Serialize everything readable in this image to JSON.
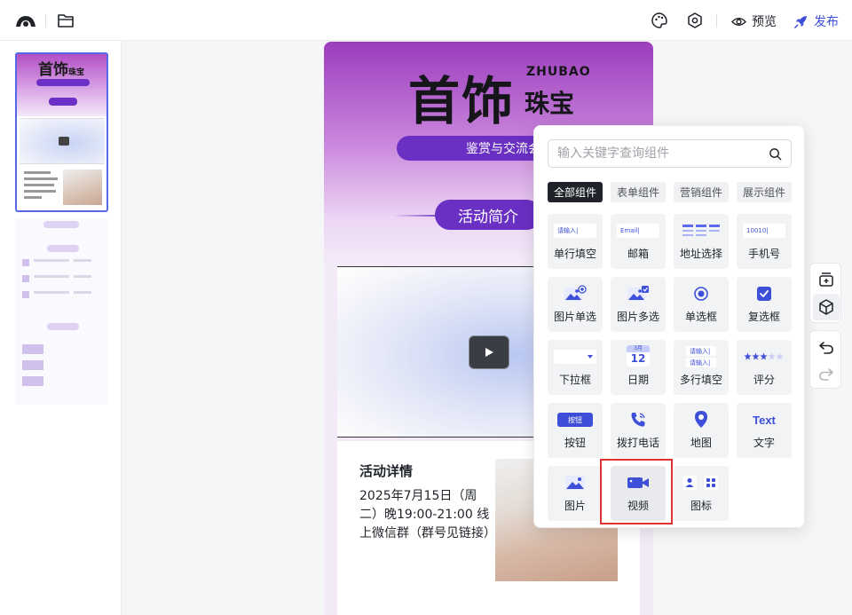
{
  "topbar": {
    "logo_icon": "cloud-logo-icon",
    "folder_icon": "folder-icon",
    "theme_icon": "palette-icon",
    "settings_icon": "settings-icon",
    "preview_label": "预览",
    "publish_label": "发布",
    "accent": "#3d4fd8"
  },
  "canvas": {
    "brand_cn_big": "首饰",
    "brand_en": "ZHUBAO",
    "brand_cn_small": "珠宝",
    "exchange_pill": "鉴赏与交流会",
    "intro_pill": "活动简介",
    "detail_title": "活动详情",
    "detail_body": "2025年7月15日（周二）晚19:00-21:00 线上微信群（群号见链接）",
    "brand_purple": "#6a2fc3"
  },
  "component_panel": {
    "search_placeholder": "输入关键字查询组件",
    "tabs": [
      {
        "label": "全部组件",
        "active": true
      },
      {
        "label": "表单组件",
        "active": false
      },
      {
        "label": "营销组件",
        "active": false
      },
      {
        "label": "展示组件",
        "active": false
      }
    ],
    "components": [
      {
        "label": "单行填空",
        "icon": "single-line-input-icon",
        "preview": "请输入|"
      },
      {
        "label": "邮箱",
        "icon": "email-icon",
        "preview": "Email|"
      },
      {
        "label": "地址选择",
        "icon": "address-icon"
      },
      {
        "label": "手机号",
        "icon": "phone-number-icon",
        "preview": "10010|"
      },
      {
        "label": "图片单选",
        "icon": "image-single-choice-icon"
      },
      {
        "label": "图片多选",
        "icon": "image-multi-choice-icon"
      },
      {
        "label": "单选框",
        "icon": "radio-icon"
      },
      {
        "label": "复选框",
        "icon": "checkbox-icon"
      },
      {
        "label": "下拉框",
        "icon": "dropdown-icon"
      },
      {
        "label": "日期",
        "icon": "calendar-icon",
        "month": "3月",
        "day": "12"
      },
      {
        "label": "多行填空",
        "icon": "multi-line-input-icon",
        "preview": "请输入|"
      },
      {
        "label": "评分",
        "icon": "rating-icon"
      },
      {
        "label": "按钮",
        "icon": "button-icon",
        "preview": "按钮"
      },
      {
        "label": "拨打电话",
        "icon": "phone-call-icon"
      },
      {
        "label": "地图",
        "icon": "map-pin-icon"
      },
      {
        "label": "文字",
        "icon": "text-icon",
        "preview": "Text"
      },
      {
        "label": "图片",
        "icon": "image-icon"
      },
      {
        "label": "视频",
        "icon": "video-icon",
        "selected": true
      },
      {
        "label": "图标",
        "icon": "icon-grid-icon"
      }
    ]
  },
  "right_toolbar": {
    "icons": [
      "add-component-icon",
      "cube-icon",
      "undo-icon",
      "redo-icon"
    ]
  }
}
